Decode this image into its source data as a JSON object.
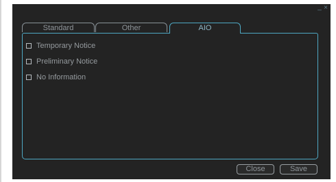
{
  "window": {
    "minimize_glyph": "_",
    "close_glyph": "×"
  },
  "tabs": [
    {
      "label": "Standard",
      "active": false
    },
    {
      "label": "Other",
      "active": false
    },
    {
      "label": "AIO",
      "active": true
    }
  ],
  "options": [
    {
      "label": "Temporary Notice",
      "checked": false
    },
    {
      "label": "Preliminary Notice",
      "checked": false
    },
    {
      "label": "No Information",
      "checked": false
    }
  ],
  "buttons": {
    "close_label": "Close",
    "save_label": "Save"
  },
  "colors": {
    "dialog_background": "#232323",
    "accent": "#4fa9c4",
    "text": "#959a9e",
    "page_background": "#ffffff"
  }
}
